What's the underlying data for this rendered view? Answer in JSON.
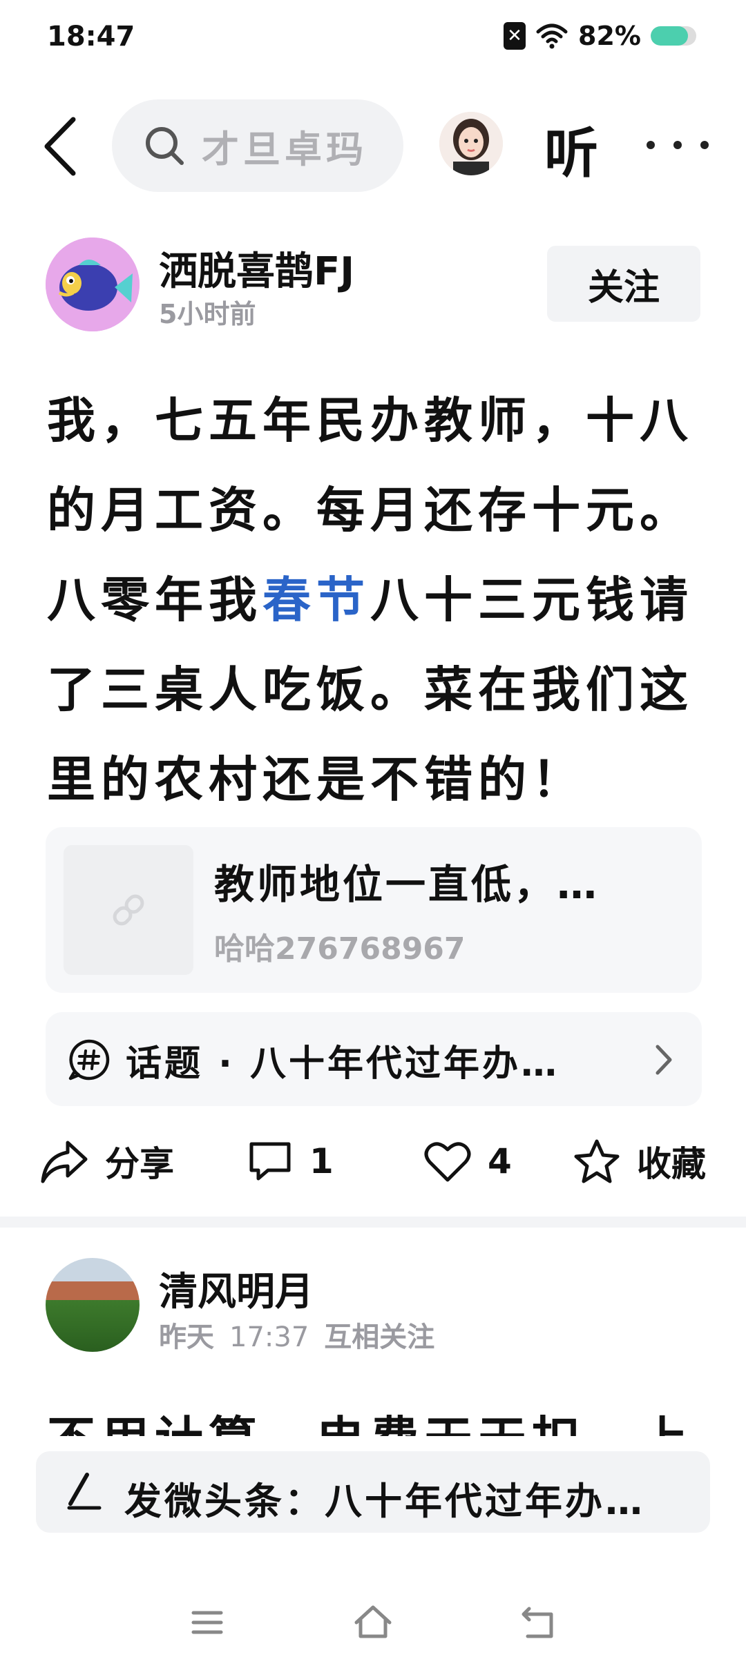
{
  "status_bar": {
    "time": "18:47",
    "battery_text": "82%",
    "battery_level": 0.82,
    "notification_icon": "x-badge-icon",
    "wifi_icon": "wifi-icon"
  },
  "top_nav": {
    "search_text": "才旦卓玛",
    "listen_label": "听"
  },
  "post1": {
    "author_name": "洒脱喜鹊FJ",
    "time": "5小时前",
    "follow_label": "关注",
    "text_before": "我，七五年民办教师，十八的月工资。每月还存十元。八零年我",
    "text_highlight": "春节",
    "text_after": "八十三元钱请了三桌人吃饭。菜在我们这里的农村还是不错的！",
    "link_card": {
      "title": "教师地位一直低，…",
      "source": "哈哈276768967"
    },
    "topic": {
      "text": "话题 · 八十年代过年办…"
    },
    "actions": {
      "share_label": "分享",
      "comment_count": "1",
      "like_count": "4",
      "favorite_label": "收藏"
    }
  },
  "post2": {
    "author_name": "清风明月",
    "date": "昨天",
    "time": "17:37",
    "relation": "互相关注",
    "text": "不用计算，电费天天扣。上"
  },
  "compose": {
    "text": "发微头条：八十年代过年办…"
  },
  "colors": {
    "highlight": "#2a64c8",
    "battery": "#4ccfae",
    "author_avatar_bg": "#e7a8ea"
  }
}
